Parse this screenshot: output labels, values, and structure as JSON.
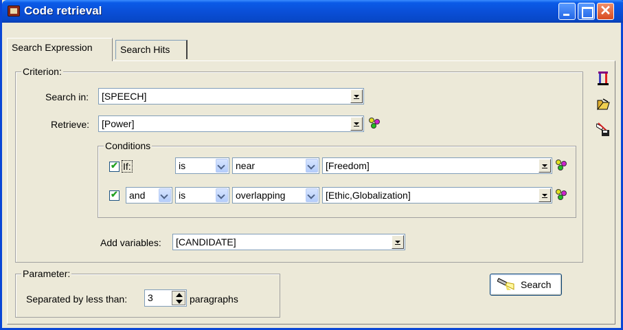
{
  "window": {
    "title": "Code retrieval"
  },
  "tabs": [
    {
      "label": "Search Expression",
      "active": true
    },
    {
      "label": "Search Hits",
      "active": false
    }
  ],
  "criterion": {
    "group_label": "Criterion:",
    "search_in_label": "Search in:",
    "search_in_value": "[SPEECH]",
    "retrieve_label": "Retrieve:",
    "retrieve_value": "[Power]"
  },
  "conditions": {
    "group_label": "Conditions",
    "rows": [
      {
        "checked": true,
        "connector": "If:",
        "operator": "is",
        "relation": "near",
        "value": "[Freedom]"
      },
      {
        "checked": true,
        "connector": "and",
        "operator": "is",
        "relation": "overlapping",
        "value": "[Ethic,Globalization]"
      }
    ]
  },
  "variables": {
    "label": "Add variables:",
    "value": "[CANDIDATE]"
  },
  "parameter": {
    "group_label": "Parameter:",
    "separated_label": "Separated by less than:",
    "separated_value": "3",
    "unit_label": "paragraphs"
  },
  "actions": {
    "search_label": "Search"
  },
  "side_icons": [
    "column-chart-icon",
    "open-folder-icon",
    "clear-save-icon"
  ],
  "colors": {
    "titlebar": "#0A4FD8",
    "check": "#21A121"
  }
}
